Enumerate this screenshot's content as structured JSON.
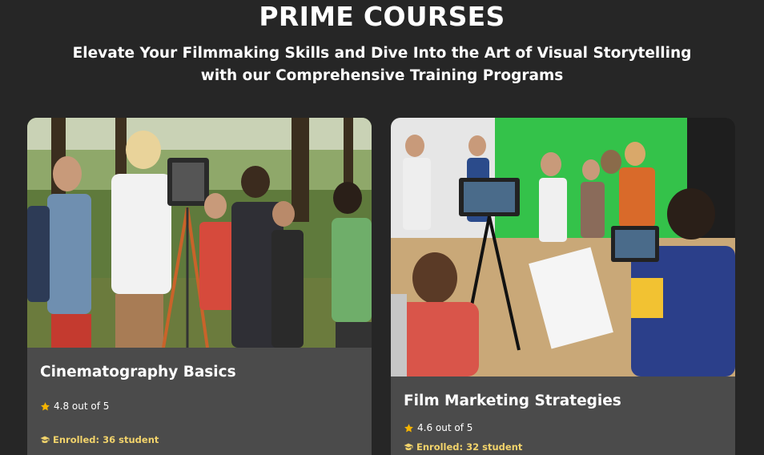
{
  "header": {
    "title": "PRIME COURSES",
    "subtitle": "Elevate Your Filmmaking Skills and Dive Into the Art of Visual Storytelling with our Comprehensive Training Programs"
  },
  "courses": [
    {
      "title": "Cinematography Basics",
      "rating": "4.8 out of 5",
      "enrolled": "Enrolled: 36 student",
      "image_icon": "photo-students-with-camera"
    },
    {
      "title": "Film Marketing Strategies",
      "rating": "4.6 out of 5",
      "enrolled": "Enrolled: 32 student",
      "image_icon": "photo-green-screen-studio"
    }
  ],
  "colors": {
    "background": "#262626",
    "card": "#4b4b4b",
    "star": "#f5b400",
    "enrolled_text": "#f2d36b"
  },
  "icons": {
    "rating": "star-icon",
    "enrolled": "graduation-cap-icon"
  }
}
